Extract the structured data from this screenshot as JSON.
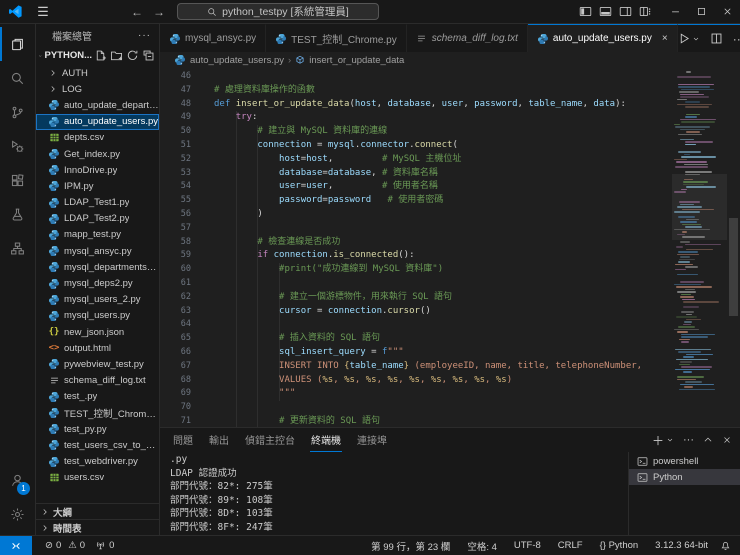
{
  "window": {
    "search_text": "python_testpy [系統管理員]",
    "layout_icons": [
      "toggle-sidebar",
      "toggle-panel",
      "toggle-secondary-sidebar",
      "customize-layout"
    ],
    "controls": [
      "minimize",
      "maximize",
      "close"
    ]
  },
  "activity_bar": {
    "items": [
      {
        "name": "explorer",
        "active": true
      },
      {
        "name": "search",
        "active": false
      },
      {
        "name": "source-control",
        "active": false
      },
      {
        "name": "run-debug",
        "active": false
      },
      {
        "name": "extensions",
        "active": false
      },
      {
        "name": "testing",
        "active": false
      },
      {
        "name": "hierarchy",
        "active": false
      }
    ],
    "bottom": [
      {
        "name": "accounts",
        "badge": "1"
      },
      {
        "name": "settings"
      }
    ]
  },
  "sidebar": {
    "title": "檔案總管",
    "section": "PYTHON...",
    "section_actions": [
      "new-file",
      "new-folder",
      "refresh",
      "collapse-all"
    ],
    "files": [
      {
        "name": "AUTH",
        "icon": "folder"
      },
      {
        "name": "LOG",
        "icon": "folder"
      },
      {
        "name": "auto_update_departm...",
        "icon": "py"
      },
      {
        "name": "auto_update_users.py",
        "icon": "py",
        "selected": true
      },
      {
        "name": "depts.csv",
        "icon": "csv"
      },
      {
        "name": "Get_index.py",
        "icon": "py"
      },
      {
        "name": "InnoDrive.py",
        "icon": "py"
      },
      {
        "name": "IPM.py",
        "icon": "py"
      },
      {
        "name": "LDAP_Test1.py",
        "icon": "py"
      },
      {
        "name": "LDAP_Test2.py",
        "icon": "py"
      },
      {
        "name": "mapp_test.py",
        "icon": "py"
      },
      {
        "name": "mysql_ansyc.py",
        "icon": "py"
      },
      {
        "name": "mysql_departments.py",
        "icon": "py"
      },
      {
        "name": "mysql_deps2.py",
        "icon": "py"
      },
      {
        "name": "mysql_users_2.py",
        "icon": "py"
      },
      {
        "name": "mysql_users.py",
        "icon": "py"
      },
      {
        "name": "new_json.json",
        "icon": "json"
      },
      {
        "name": "output.html",
        "icon": "html"
      },
      {
        "name": "pywebview_test.py",
        "icon": "py"
      },
      {
        "name": "schema_diff_log.txt",
        "icon": "txt"
      },
      {
        "name": "test_.py",
        "icon": "py"
      },
      {
        "name": "TEST_控制_Chrome.py",
        "icon": "py"
      },
      {
        "name": "test_py.py",
        "icon": "py"
      },
      {
        "name": "test_users_csv_to_mys...",
        "icon": "py"
      },
      {
        "name": "test_webdriver.py",
        "icon": "py"
      },
      {
        "name": "users.csv",
        "icon": "csv"
      }
    ],
    "bottom_sections": [
      "大綱",
      "時間表"
    ]
  },
  "tabs": [
    {
      "name": "mysql_ansyc.py",
      "icon": "py"
    },
    {
      "name": "TEST_控制_Chrome.py",
      "icon": "py"
    },
    {
      "name": "schema_diff_log.txt",
      "icon": "txt",
      "italic": true
    },
    {
      "name": "auto_update_users.py",
      "icon": "py",
      "active": true,
      "close": "×"
    }
  ],
  "breadcrumb": {
    "file": "auto_update_users.py",
    "symbol": "insert_or_update_data"
  },
  "code": {
    "lines": [
      {
        "n": 46,
        "s": []
      },
      {
        "n": 47,
        "s": [
          [
            "cm",
            "# 處理資料庫操作的函數"
          ]
        ]
      },
      {
        "n": 48,
        "s": [
          [
            "kw",
            "def "
          ],
          [
            "fn",
            "insert_or_update_data"
          ],
          [
            "pn",
            "("
          ],
          [
            "vr",
            "host"
          ],
          [
            "pn",
            ", "
          ],
          [
            "vr",
            "database"
          ],
          [
            "pn",
            ", "
          ],
          [
            "vr",
            "user"
          ],
          [
            "pn",
            ", "
          ],
          [
            "vr",
            "password"
          ],
          [
            "pn",
            ", "
          ],
          [
            "vr",
            "table_name"
          ],
          [
            "pn",
            ", "
          ],
          [
            "vr",
            "data"
          ],
          [
            "pn",
            "):"
          ]
        ]
      },
      {
        "n": 49,
        "s": [
          [
            "pn",
            "    "
          ],
          [
            "ct",
            "try"
          ],
          [
            "pn",
            ":"
          ]
        ]
      },
      {
        "n": 50,
        "s": [
          [
            "pn",
            "        "
          ],
          [
            "cm",
            "# 建立與 MySQL 資料庫的連線"
          ]
        ]
      },
      {
        "n": 51,
        "s": [
          [
            "pn",
            "        "
          ],
          [
            "vr",
            "connection"
          ],
          [
            "pn",
            " = "
          ],
          [
            "vr",
            "mysql"
          ],
          [
            "pn",
            "."
          ],
          [
            "vr",
            "connector"
          ],
          [
            "pn",
            "."
          ],
          [
            "fn",
            "connect"
          ],
          [
            "pn",
            "("
          ]
        ]
      },
      {
        "n": 52,
        "s": [
          [
            "pn",
            "            "
          ],
          [
            "vr",
            "host"
          ],
          [
            "pn",
            "="
          ],
          [
            "vr",
            "host"
          ],
          [
            "pn",
            ",         "
          ],
          [
            "cm",
            "# MySQL 主機位址"
          ]
        ]
      },
      {
        "n": 53,
        "s": [
          [
            "pn",
            "            "
          ],
          [
            "vr",
            "database"
          ],
          [
            "pn",
            "="
          ],
          [
            "vr",
            "database"
          ],
          [
            "pn",
            ", "
          ],
          [
            "cm",
            "# 資料庫名稱"
          ]
        ]
      },
      {
        "n": 54,
        "s": [
          [
            "pn",
            "            "
          ],
          [
            "vr",
            "user"
          ],
          [
            "pn",
            "="
          ],
          [
            "vr",
            "user"
          ],
          [
            "pn",
            ",         "
          ],
          [
            "cm",
            "# 使用者名稱"
          ]
        ]
      },
      {
        "n": 55,
        "s": [
          [
            "pn",
            "            "
          ],
          [
            "vr",
            "password"
          ],
          [
            "pn",
            "="
          ],
          [
            "vr",
            "password"
          ],
          [
            "pn",
            "   "
          ],
          [
            "cm",
            "# 使用者密碼"
          ]
        ]
      },
      {
        "n": 56,
        "s": [
          [
            "pn",
            "        )"
          ]
        ]
      },
      {
        "n": 57,
        "s": []
      },
      {
        "n": 58,
        "s": [
          [
            "pn",
            "        "
          ],
          [
            "cm",
            "# 檢查連線是否成功"
          ]
        ]
      },
      {
        "n": 59,
        "s": [
          [
            "pn",
            "        "
          ],
          [
            "ct",
            "if "
          ],
          [
            "vr",
            "connection"
          ],
          [
            "pn",
            "."
          ],
          [
            "fn",
            "is_connected"
          ],
          [
            "pn",
            "():"
          ]
        ]
      },
      {
        "n": 60,
        "s": [
          [
            "pn",
            "            "
          ],
          [
            "cm",
            "#print(\"成功連線到 MySQL 資料庫\")"
          ]
        ]
      },
      {
        "n": 61,
        "s": []
      },
      {
        "n": 62,
        "s": [
          [
            "pn",
            "            "
          ],
          [
            "cm",
            "# 建立一個游標物件，用來執行 SQL 語句"
          ]
        ]
      },
      {
        "n": 63,
        "s": [
          [
            "pn",
            "            "
          ],
          [
            "vr",
            "cursor"
          ],
          [
            "pn",
            " = "
          ],
          [
            "vr",
            "connection"
          ],
          [
            "pn",
            "."
          ],
          [
            "fn",
            "cursor"
          ],
          [
            "pn",
            "()"
          ]
        ]
      },
      {
        "n": 64,
        "s": []
      },
      {
        "n": 65,
        "s": [
          [
            "pn",
            "            "
          ],
          [
            "cm",
            "# 插入資料的 SQL 語句"
          ]
        ]
      },
      {
        "n": 66,
        "s": [
          [
            "pn",
            "            "
          ],
          [
            "vr",
            "sql_insert_query"
          ],
          [
            "pn",
            " = "
          ],
          [
            "kw",
            "f"
          ],
          [
            "st",
            "\"\"\""
          ]
        ]
      },
      {
        "n": 67,
        "s": [
          [
            "pn",
            "            "
          ],
          [
            "st",
            "INSERT INTO "
          ],
          [
            "fs",
            "{"
          ],
          [
            "vr",
            "table_name"
          ],
          [
            "fs",
            "}"
          ],
          [
            "st",
            " (employeeID, name, title, telephoneNumber,"
          ]
        ]
      },
      {
        "n": 68,
        "s": [
          [
            "pn",
            "            "
          ],
          [
            "st",
            "VALUES ("
          ],
          [
            "fs",
            "%s"
          ],
          [
            "st",
            ", "
          ],
          [
            "fs",
            "%s"
          ],
          [
            "st",
            ", "
          ],
          [
            "fs",
            "%s"
          ],
          [
            "st",
            ", "
          ],
          [
            "fs",
            "%s"
          ],
          [
            "st",
            ", "
          ],
          [
            "fs",
            "%s"
          ],
          [
            "st",
            ", "
          ],
          [
            "fs",
            "%s"
          ],
          [
            "st",
            ", "
          ],
          [
            "fs",
            "%s"
          ],
          [
            "st",
            ", "
          ],
          [
            "fs",
            "%s"
          ],
          [
            "st",
            ", "
          ],
          [
            "fs",
            "%s"
          ],
          [
            "st",
            ")"
          ]
        ]
      },
      {
        "n": 69,
        "s": [
          [
            "pn",
            "            "
          ],
          [
            "st",
            "\"\"\""
          ]
        ]
      },
      {
        "n": 70,
        "s": []
      },
      {
        "n": 71,
        "s": [
          [
            "pn",
            "            "
          ],
          [
            "cm",
            "# 更新資料的 SQL 語句"
          ]
        ]
      }
    ]
  },
  "panel": {
    "tabs": [
      {
        "label": "問題"
      },
      {
        "label": "輸出"
      },
      {
        "label": "偵錯主控台"
      },
      {
        "label": "終端機",
        "active": true
      },
      {
        "label": "連接埠"
      }
    ],
    "output": [
      ".py",
      "LDAP 認證成功",
      "部門代號：82*: 275筆",
      "部門代號：89*: 108筆",
      "部門代號：8D*: 103筆",
      "部門代號：8F*: 247筆"
    ],
    "terminals": [
      {
        "name": "powershell"
      },
      {
        "name": "Python",
        "active": true
      }
    ]
  },
  "status_bar": {
    "problems": {
      "errors": "0",
      "warnings": "0"
    },
    "ports": "0",
    "right_items": [
      "第 99 行，第 23 欄",
      "空格: 4",
      "UTF-8",
      "CRLF",
      "{} Python",
      "3.12.3 64-bit"
    ]
  },
  "colors": {
    "accent": "#0078d4",
    "selection": "#04395e",
    "comment": "#6a9955",
    "string": "#ce9178"
  }
}
